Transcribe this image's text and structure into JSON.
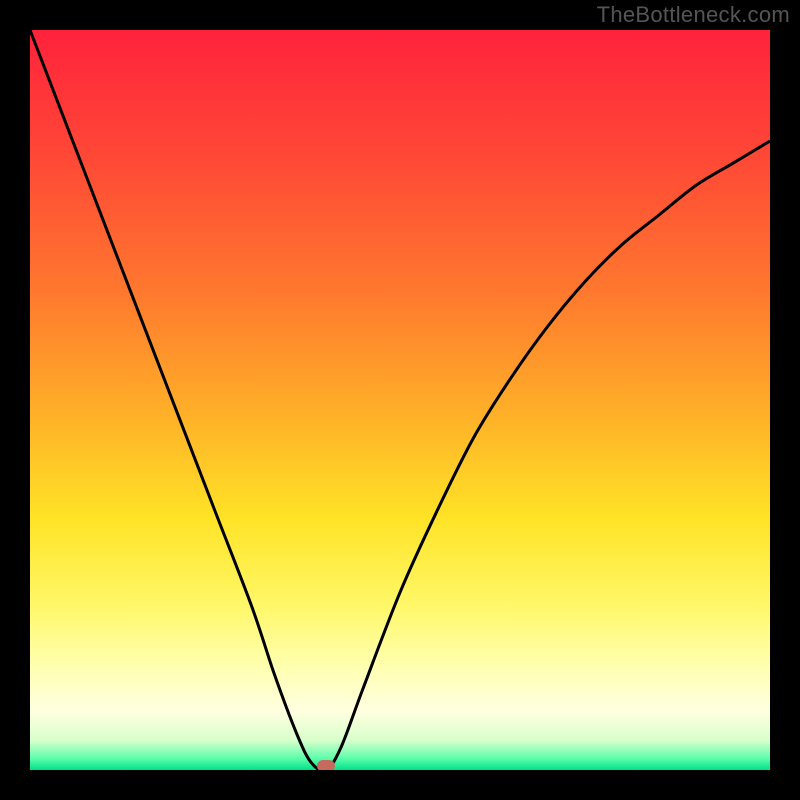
{
  "watermark": "TheBottleneck.com",
  "colors": {
    "frame": "#000000",
    "curve": "#000000",
    "gradient_stops": [
      {
        "offset": 0.0,
        "color": "#ff223c"
      },
      {
        "offset": 0.18,
        "color": "#ff4a36"
      },
      {
        "offset": 0.36,
        "color": "#ff7a2e"
      },
      {
        "offset": 0.52,
        "color": "#ffb028"
      },
      {
        "offset": 0.66,
        "color": "#ffe326"
      },
      {
        "offset": 0.78,
        "color": "#fff86a"
      },
      {
        "offset": 0.86,
        "color": "#ffffb0"
      },
      {
        "offset": 0.92,
        "color": "#ffffe0"
      },
      {
        "offset": 0.96,
        "color": "#d8ffcc"
      },
      {
        "offset": 0.985,
        "color": "#58fdaa"
      },
      {
        "offset": 1.0,
        "color": "#00e08a"
      }
    ],
    "marker": "#c66a5d"
  },
  "chart_data": {
    "type": "line",
    "title": "",
    "xlabel": "",
    "ylabel": "",
    "xlim": [
      0,
      100
    ],
    "ylim": [
      0,
      100
    ],
    "grid": false,
    "series": [
      {
        "name": "bottleneck-curve",
        "x": [
          0,
          5,
          10,
          15,
          20,
          25,
          30,
          33,
          36,
          38,
          40,
          42,
          45,
          50,
          55,
          60,
          65,
          70,
          75,
          80,
          85,
          90,
          95,
          100
        ],
        "y": [
          100,
          87,
          74,
          61,
          48,
          35,
          22,
          13,
          5,
          1,
          0,
          3,
          11,
          24,
          35,
          45,
          53,
          60,
          66,
          71,
          75,
          79,
          82,
          85
        ]
      }
    ],
    "annotations": [
      {
        "name": "optimal-marker",
        "x": 40,
        "y": 0.5
      }
    ]
  },
  "layout": {
    "image_size": 800,
    "plot_inset": 30
  }
}
